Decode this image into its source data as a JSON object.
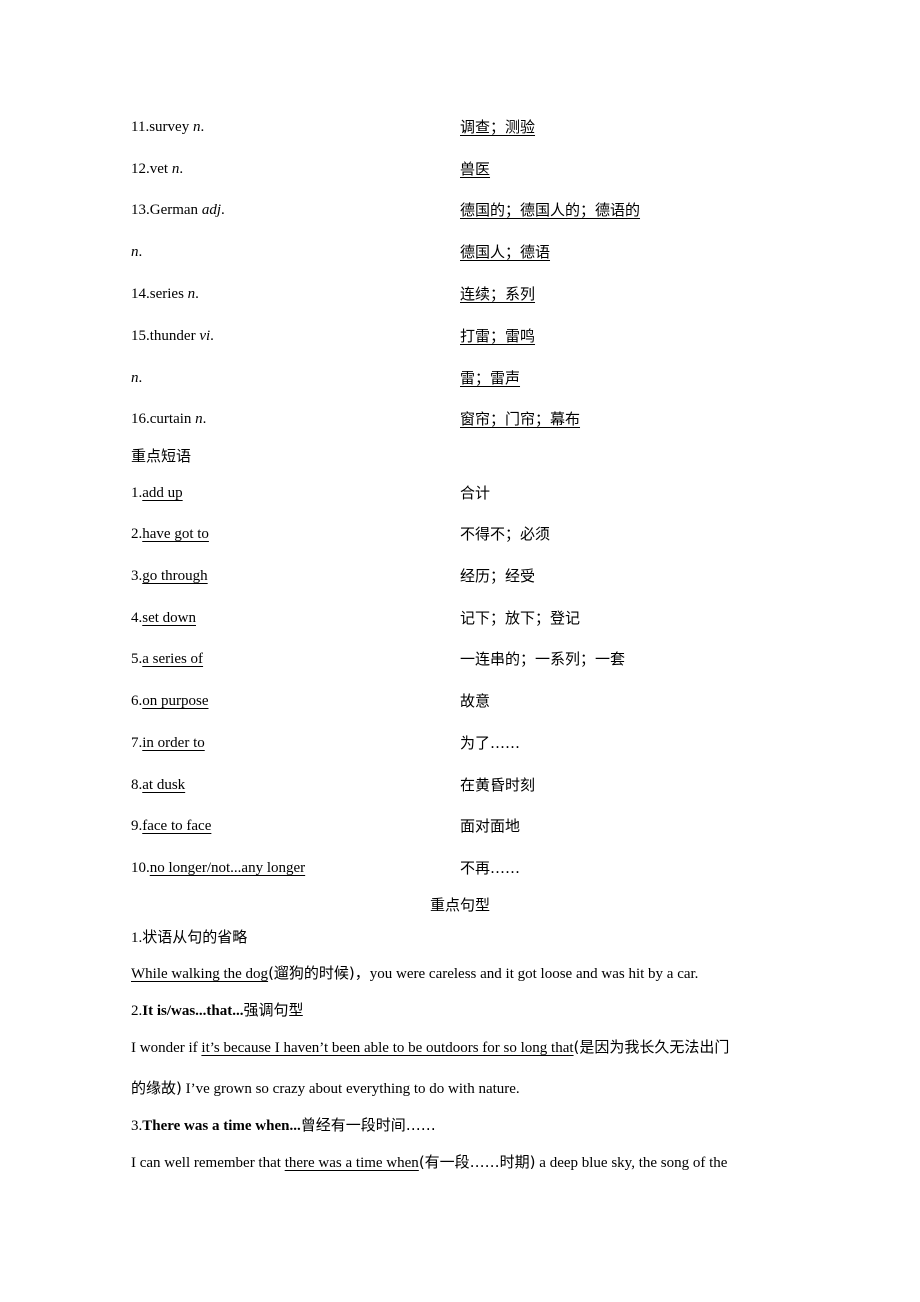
{
  "vocabulary": [
    {
      "num": "11.",
      "word": "survey",
      "pos": "n",
      "pos_suffix": ".",
      "meaning": "调查；测验"
    },
    {
      "num": "12.",
      "word": "vet",
      "pos": "n",
      "pos_suffix": ".",
      "meaning": "兽医"
    },
    {
      "num": "13.",
      "word": "German",
      "pos": "adj",
      "pos_suffix": ".",
      "meaning": "德国的；德国人的；德语的"
    },
    {
      "num": "",
      "word": "",
      "pos": "n",
      "pos_suffix": ".",
      "meaning": "德国人；德语"
    },
    {
      "num": "14.",
      "word": "series",
      "pos": "n",
      "pos_suffix": ".",
      "meaning": "连续；系列"
    },
    {
      "num": "15.",
      "word": "thunder",
      "pos": "vi",
      "pos_suffix": ".",
      "meaning": "打雷；雷鸣"
    },
    {
      "num": "",
      "word": "",
      "pos": "n",
      "pos_suffix": ".",
      "meaning": "雷；雷声"
    },
    {
      "num": "16.",
      "word": "curtain",
      "pos": "n",
      "pos_suffix": ".",
      "meaning": "窗帘；门帘；幕布"
    }
  ],
  "phrases_heading": "重点短语",
  "phrases": [
    {
      "num": "1.",
      "phrase": "add up",
      "meaning": "合计"
    },
    {
      "num": "2.",
      "phrase": "have got to",
      "meaning": "不得不；必须"
    },
    {
      "num": "3.",
      "phrase": "go through",
      "meaning": "经历；经受"
    },
    {
      "num": "4.",
      "phrase": "set down",
      "meaning": "记下；放下；登记"
    },
    {
      "num": "5.",
      "phrase": "a series of",
      "meaning": "一连串的；一系列；一套"
    },
    {
      "num": "6.",
      "phrase": "on purpose",
      "meaning": "故意"
    },
    {
      "num": "7.",
      "phrase": "in order to",
      "meaning": "为了……"
    },
    {
      "num": "8.",
      "phrase": "at dusk",
      "meaning": "在黄昏时刻"
    },
    {
      "num": "9.",
      "phrase": "face to face",
      "meaning": "面对面地"
    },
    {
      "num": "10.",
      "phrase": "no longer/not...any longer",
      "meaning": "不再……"
    }
  ],
  "sentences_heading": "重点句型",
  "sentence_patterns": [
    {
      "title_num": "1.",
      "title_bold": "",
      "title_rest": "状语从句的省略",
      "example": {
        "prefix": "",
        "underlined": "While walking the dog",
        "gloss": "(遛狗的时候)，",
        "suffix": "you were careless and it got loose and was hit by a car."
      }
    },
    {
      "title_num": "2.",
      "title_bold": "It is/was...that...",
      "title_rest": "强调句型",
      "example": {
        "prefix": "I wonder if ",
        "underlined": "it’s because I haven’t been able to be outdoors for so long that",
        "gloss": "(是因为我长久无法出门",
        "line2_gloss": "的缘故)",
        "suffix": " I’ve grown so crazy about everything to do with nature."
      }
    },
    {
      "title_num": "3.",
      "title_bold": "There was a time when...",
      "title_rest": "曾经有一段时间……",
      "example": {
        "prefix": "I can well remember that ",
        "underlined": "there was a time when",
        "gloss": "(有一段……时期)",
        "suffix": " a deep blue sky, the song of the"
      }
    }
  ]
}
